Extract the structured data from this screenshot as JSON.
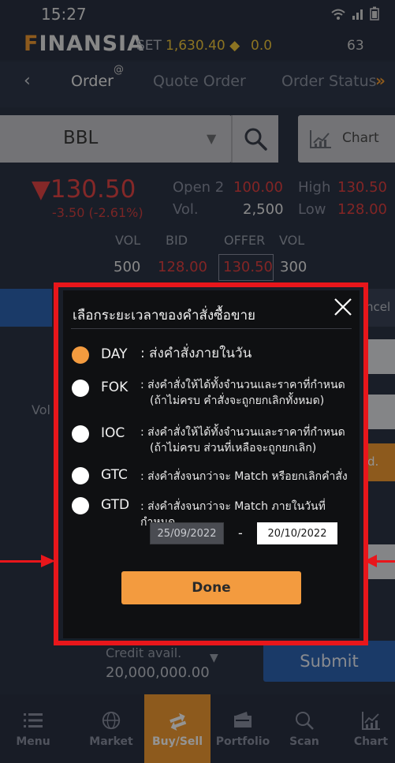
{
  "status_bar": {
    "time": "15:27",
    "icons": "wifi signal battery"
  },
  "ticker": {
    "brand_first": "F",
    "brand_rest": "INANSIA",
    "index": "SET",
    "value": "1,630.40 ◆",
    "change": "0.0",
    "extra": "63"
  },
  "tabs": {
    "order": "Order",
    "quote": "Quote Order",
    "status": "Order Status"
  },
  "symbol": {
    "value": "BBL",
    "chart_label": "Chart"
  },
  "quote": {
    "last": "▼130.50",
    "change": "-3.50 (-2.61%)",
    "open_label": "Open 2",
    "open_value": "100.00",
    "high_label": "High",
    "high_value": "130.50",
    "vol_label": "Vol.",
    "vol_value": "2,500",
    "low_label": "Low",
    "low_value": "128.00"
  },
  "bid_offer": {
    "headers": [
      "VOL",
      "BID",
      "OFFER",
      "VOL"
    ],
    "bid_vol": "500",
    "bid": "128.00",
    "offer": "130.50",
    "offer_vol": "300"
  },
  "background_fragments": {
    "cancel_partial": "ncel",
    "vol_partial": "Vol",
    "orange_partial": "d."
  },
  "footer": {
    "credit_label": "Credit avail.",
    "credit_value": "20,000,000.00",
    "submit": "Submit"
  },
  "bottom_nav": [
    {
      "label": "Menu",
      "icon": "list-icon"
    },
    {
      "label": "Market",
      "icon": "globe-icon"
    },
    {
      "label": "Buy/Sell",
      "icon": "swap-icon"
    },
    {
      "label": "Portfolio",
      "icon": "wallet-icon"
    },
    {
      "label": "Scan",
      "icon": "search-icon"
    },
    {
      "label": "Chart",
      "icon": "chart-icon"
    }
  ],
  "modal": {
    "title": "เลือกระยะเวลาของคำสั่งซื้อขาย",
    "options": [
      {
        "code": "DAY",
        "desc1": ": ส่งคำสั่งภายในวัน",
        "desc2": "",
        "selected": true
      },
      {
        "code": "FOK",
        "desc1": ": ส่งคำสั่งให้ได้ทั้งจำนวนและราคาที่กำหนด",
        "desc2": "(ถ้าไม่ครบ คำสั่งจะถูกยกเลิกทั้งหมด)",
        "selected": false
      },
      {
        "code": "IOC",
        "desc1": ": ส่งคำสั่งให้ได้ทั้งจำนวนและราคาที่กำหนด",
        "desc2": "(ถ้าไม่ครบ ส่วนที่เหลือจะถูกยกเลิก)",
        "selected": false
      },
      {
        "code": "GTC",
        "desc1": ": ส่งคำสั่งจนกว่าจะ Match หรือยกเลิกคำสั่ง",
        "desc2": "",
        "selected": false
      },
      {
        "code": "GTD",
        "desc1": ": ส่งคำสั่งจนกว่าจะ Match ภายในวันที่กำหนด",
        "desc2": "",
        "selected": false
      }
    ],
    "date_from": "25/09/2022",
    "date_separator": "-",
    "date_to": "20/10/2022",
    "done": "Done"
  },
  "colors": {
    "accent": "#f39b3f",
    "highlight_border": "#e8161b",
    "price_down": "#e34545",
    "submit_blue": "#2d64b3"
  }
}
